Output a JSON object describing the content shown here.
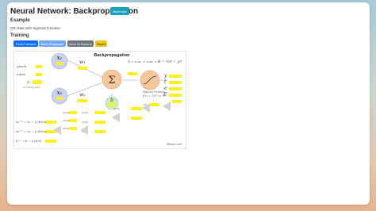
{
  "header": {
    "title": "Neural Network: Backpropagation",
    "next_button": "Next topic"
  },
  "example": {
    "heading": "Example",
    "subtitle": "OR Gate with Sigmoid Function"
  },
  "training": {
    "heading": "Training",
    "buttons": {
      "feed_forward": "Feed Forward",
      "back_propagate": "Back Propagate",
      "train_epochs": "Next 10 Epochs",
      "reset": "Reset"
    }
  },
  "diagram": {
    "title": "Backpropagation",
    "inputs": {
      "x1": "x₁",
      "x2": "x₂"
    },
    "weights": {
      "w1": "w₁",
      "w2": "w₂"
    },
    "bias": "b",
    "sum_symbol": "Σ",
    "sum_formula": "Σ = x₁w₁ + x₂w₂ + b",
    "error_formula": "E = ½(t − y)²",
    "activation_label": "Sigmoid Function",
    "activation_formula": "f(z) = 1/(1+e⁻ᶻ)",
    "params": {
      "epoch": "epoch",
      "input": "input",
      "eta": "η"
    },
    "eta_note": "(learning rate)",
    "outputs": {
      "y": "y",
      "t": "t",
      "e": "e",
      "E": "E"
    },
    "updates": {
      "w1": "w₁ⁿᵉʷ = w₁ − η ∂E/∂w₁",
      "w2": "w₂ⁿᵉʷ = w₂ − η ∂E/∂w₂",
      "b": "bⁿᵉʷ = b − η ∂E/∂b"
    },
    "watermark": "3Blue1.net"
  },
  "colors": {
    "node_fill": "#c9d3ef",
    "sum_fill": "#f6c79b",
    "bias_fill": "#c9efc0",
    "value_box": "#ffef1a",
    "arrow": "#bbbbbb"
  }
}
